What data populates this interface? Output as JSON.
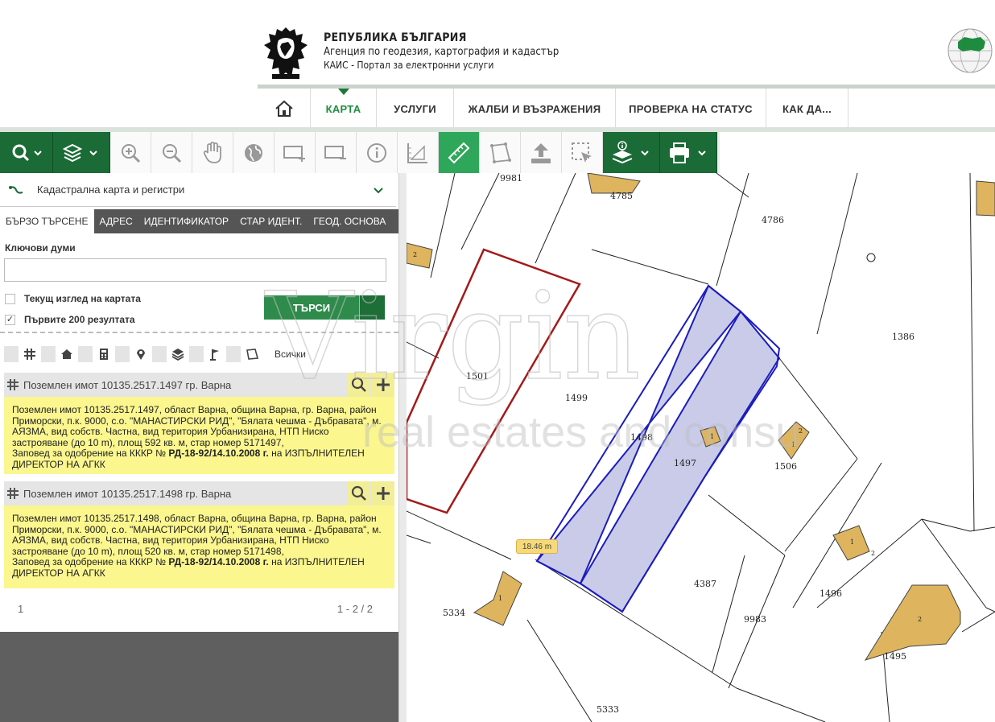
{
  "header": {
    "org_line1": "РЕПУБЛИКА БЪЛГАРИЯ",
    "org_line2": "Агенция по геодезия, картография и кадастър",
    "org_line3": "КАИС - Портал за електронни услуги"
  },
  "nav": {
    "home_icon": "home-icon",
    "items": [
      {
        "label": "КАРТА",
        "active": true
      },
      {
        "label": "УСЛУГИ"
      },
      {
        "label": "ЖАЛБИ И ВЪЗРАЖЕНИЯ"
      },
      {
        "label": "ПРОВЕРКА НА СТАТУС"
      },
      {
        "label": "КАК ДА..."
      }
    ]
  },
  "toolbar": {
    "tools": [
      "search-icon",
      "layers-icon",
      "zoom-in-icon",
      "zoom-out-icon",
      "pan-hand-icon",
      "globe-icon",
      "zoom-rect-in-icon",
      "zoom-rect-out-icon",
      "info-icon",
      "measure-coords-icon",
      "ruler-icon",
      "measure-area-icon",
      "upload-icon",
      "select-icon",
      "layer-info-icon",
      "print-icon"
    ],
    "active_tool": "ruler-icon"
  },
  "panel": {
    "layer_select": "Кадастрална карта и регистри",
    "tabs": [
      "БЪРЗО ТЪРСЕНЕ",
      "АДРЕС",
      "ИДЕНТИФИКАТОР",
      "СТАР ИДЕНТ.",
      "ГЕОД. ОСНОВА"
    ],
    "keywords_label": "Ключови думи",
    "keywords_value": "",
    "current_view_label": "Текущ изглед на картата",
    "first200_label": "Първите 200 резултата",
    "first200_checked": "✓",
    "search_button": "ТЪРСИ",
    "filter_all": "Всички",
    "results": [
      {
        "title": "Поземлен имот 10135.2517.1497 гр. Варна",
        "desc_main": "Поземлен имот 10135.2517.1497, област Варна, община Варна, гр. Варна, район Приморски, п.к. 9000, с.о. \"МАНАСТИРСКИ РИД\", \"Бялата чешма - Дъбравата\", м. АЯЗМА, вид собств. Частна, вид територия Урбанизирана, НТП Ниско застрояване (до 10 m), площ 592 кв. м, стар номер 5171497,",
        "desc_order_prefix": "Заповед за одобрение на КККР № ",
        "desc_order": "РД-18-92/14.10.2008 г.",
        "desc_order_suffix": " на ИЗПЪЛНИТЕЛЕН ДИРЕКТОР НА АГКК"
      },
      {
        "title": "Поземлен имот 10135.2517.1498 гр. Варна",
        "desc_main": "Поземлен имот 10135.2517.1498, област Варна, община Варна, гр. Варна, район Приморски, п.к. 9000, с.о. \"МАНАСТИРСКИ РИД\", \"Бялата чешма - Дъбравата\", м. АЯЗМА, вид собств. Частна, вид територия Урбанизирана, НТП Ниско застрояване (до 10 m), площ 520 кв. м, стар номер 5171498,",
        "desc_order_prefix": "Заповед за одобрение на КККР № ",
        "desc_order": "РД-18-92/14.10.2008 г.",
        "desc_order_suffix": " на ИЗПЪЛНИТЕЛЕН ДИРЕКТОР НА АГКК"
      }
    ],
    "pager_page": "1",
    "pager_range": "1 - 2 / 2"
  },
  "map": {
    "parcel_labels": [
      "9981",
      "4785",
      "4786",
      "1386",
      "1501",
      "1499",
      "1498",
      "1497",
      "1506",
      "4387",
      "1496",
      "5334",
      "9983",
      "1495",
      "5333"
    ],
    "building_labels": [
      "2",
      "1",
      "2",
      "1",
      "1",
      "2",
      "1",
      "2"
    ],
    "measurement": "18.46 m",
    "colors": {
      "selected_fill": "#c9cbe9",
      "selected_stroke": "#1c1cc0",
      "red_outline": "#a31a1a",
      "building": "#deb45e"
    }
  },
  "watermark": {
    "brand": "Virgin",
    "tagline": "real estates and consulting"
  }
}
